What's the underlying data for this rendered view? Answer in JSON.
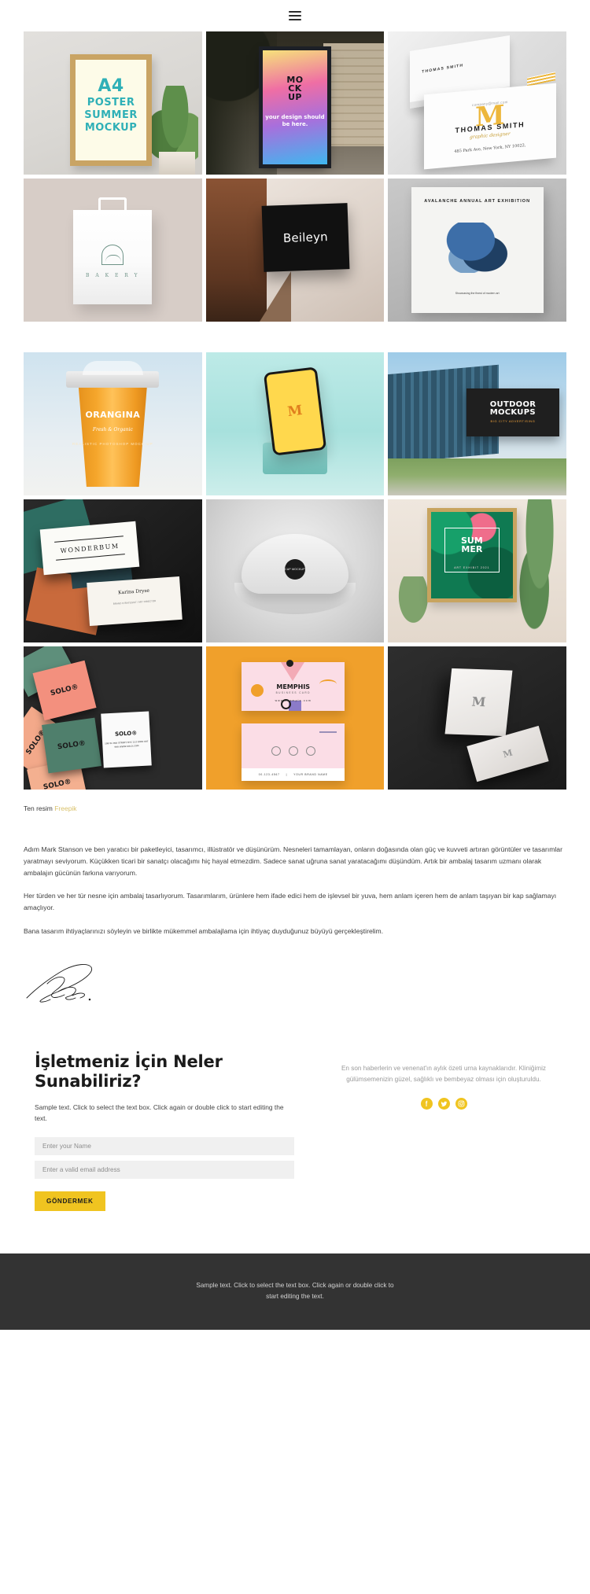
{
  "header": {
    "menu_icon": "hamburger-menu-icon"
  },
  "galleries": [
    {
      "rows": [
        [
          {
            "art": "a4-poster",
            "alt": "A4 Poster Summer Mockup",
            "text": {
              "l1": "A4",
              "l2": "POSTER",
              "l3": "SUMMER",
              "l4": "MOCKUP"
            }
          },
          {
            "art": "billboard",
            "alt": "City billboard mockup",
            "text": {
              "mock": "MO CK UP",
              "sub": "your design should be here."
            }
          },
          {
            "art": "thomas-smith",
            "alt": "Thomas Smith business card",
            "text": {
              "mail": "company@mail.com",
              "mono": "M",
              "name": "THOMAS SMITH",
              "role": "graphic designer",
              "addr": "485 Park Ave, New York, NY 10022,",
              "small": "THOMAS SMITH"
            }
          }
        ],
        [
          {
            "art": "bakery-bag",
            "alt": "Bakery paper bag mockup",
            "text": {
              "brand": "B A K E R Y"
            }
          },
          {
            "art": "beileyn-box",
            "alt": "Beileyn black box mockup",
            "text": {
              "brand": "Beileyn"
            }
          },
          {
            "art": "exhibition-poster",
            "alt": "Avalanche annual art exhibition poster",
            "text": {
              "title": "AVALANCHE ANNUAL ART EXHIBITION",
              "caption": "Showcasing the finest of modern art"
            }
          }
        ]
      ]
    },
    {
      "rows": [
        [
          {
            "art": "orangina-cup",
            "alt": "Orangina coffee cup mockup",
            "text": {
              "brand": "ORANGINA",
              "tag": "Fresh & Organic",
              "small": "REALISTIC PHOTOSHOP MOCK-UP"
            }
          },
          {
            "art": "phone-mockup",
            "alt": "Yellow phone on pedestal mockup",
            "text": {
              "mono": "M"
            }
          },
          {
            "art": "outdoor-mockups",
            "alt": "Outdoor billboard on glass building",
            "text": {
              "title": "OUTDOOR MOCKUPS",
              "sub": "BIG CITY ADVERTISING"
            }
          }
        ],
        [
          {
            "art": "wonderbum-cards",
            "alt": "Wonderbum business cards on dark marble",
            "text": {
              "brand": "WONDERBUM",
              "name": "Karina Dryse",
              "role": "BRAND STRATEGIST / ART DIRECTOR"
            }
          },
          {
            "art": "cap-mockup",
            "alt": "White cap mockup",
            "text": {
              "patch": "CAP MOCKUP"
            }
          },
          {
            "art": "summer-poster",
            "alt": "Summer art exhibit framed poster with plants",
            "text": {
              "l1": "SUM",
              "l2": "MER",
              "sub": "ART EXHIBIT 2021"
            }
          }
        ],
        [
          {
            "art": "solo-cards",
            "alt": "SOLO business cards",
            "text": {
              "brand": "SOLO®",
              "addr": "108 W 2ND STREET NYC 212 8000 007 999 WWW.SOLO.COM"
            }
          },
          {
            "art": "memphis-cards",
            "alt": "Memphis business card on orange",
            "text": {
              "title": "MEMPHIS",
              "sub": "BUSINESS CARD",
              "url": "www.example.com",
              "phone": "00-123-4567",
              "brand": "YOUR BRAND NAME"
            }
          },
          {
            "art": "dark-card",
            "alt": "Minimal card mockup on dark background",
            "text": {
              "mono": "M"
            }
          }
        ]
      ]
    }
  ],
  "credit": {
    "prefix": "Ten resim",
    "link": "Freepik"
  },
  "about": {
    "paragraphs": [
      "Adım Mark Stanson ve ben yaratıcı bir paketleyici, tasarımcı, illüstratör ve düşünürüm. Nesneleri tamamlayan, onların doğasında olan güç ve kuvveti artıran görüntüler ve tasarımlar yaratmayı seviyorum. Küçükken ticari bir sanatçı olacağımı hiç hayal etmezdim. Sadece sanat uğruna sanat yaratacağımı düşündüm. Artık bir ambalaj tasarım uzmanı olarak ambalajın gücünün farkına varıyorum.",
      "Her türden ve her tür nesne için ambalaj tasarlıyorum. Tasarımlarım, ürünlere hem ifade edici hem de işlevsel bir yuva, hem anlam içeren hem de anlam taşıyan bir kap sağlamayı amaçlıyor.",
      "Bana tasarım ihtiyaçlarınızı söyleyin ve birlikte mükemmel ambalajlama için ihtiyaç duyduğunuz büyüyü gerçekleştirelim."
    ],
    "signature_alt": "handwritten-signature"
  },
  "contact": {
    "heading": "İşletmeniz İçin Neler Sunabiliriz?",
    "lead": "Sample text. Click to select the text box. Click again or double click to start editing the text.",
    "name_placeholder": "Enter your Name",
    "name_value": "",
    "email_placeholder": "Enter a valid email address",
    "email_value": "",
    "submit_label": "GÖNDERMEK",
    "aside_text": "En son haberlerin ve venenat'ın aylık özeti urna kaynaklarıdır. Kliniğimiz gülümsemenizin güzel, sağlıklı ve bembeyaz olması için oluşturuldu.",
    "socials": [
      {
        "name": "facebook-icon",
        "glyph": "f"
      },
      {
        "name": "twitter-icon",
        "glyph": "t"
      },
      {
        "name": "instagram-icon",
        "glyph": "i"
      }
    ]
  },
  "footer": {
    "text": "Sample text. Click to select the text box. Click again or double click to start editing the text."
  },
  "colors": {
    "accent_yellow": "#f0c420",
    "credit_link": "#d9c16a",
    "footer_bg": "#333333",
    "orange_tile": "#f0a02b"
  }
}
